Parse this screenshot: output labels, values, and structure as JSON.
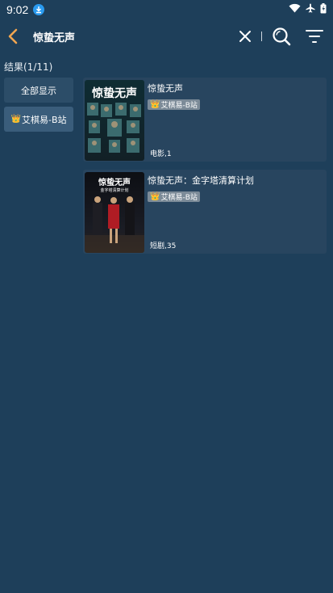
{
  "status_bar": {
    "time": "9:02"
  },
  "top_bar": {
    "query": "惊蛰无声"
  },
  "results": {
    "count_label": "结果(1/11)"
  },
  "filters": [
    {
      "label": "全部显示"
    },
    {
      "label": "艾棋易-B站"
    }
  ],
  "cards": [
    {
      "title": "惊蛰无声",
      "source": "艾棋易-B站",
      "meta": "电影,1",
      "poster_title": "惊蛰无声"
    },
    {
      "title": "惊蛰无声：金字塔清算计划",
      "source": "艾棋易-B站",
      "meta": "短剧,35",
      "poster_title": "惊蛰无声",
      "poster_subtitle": "金字塔清算计划"
    }
  ],
  "colors": {
    "background": "#1e3f5a",
    "card": "#28455f",
    "filter": "#2c4d68",
    "badge": "#7c8b98",
    "back_arrow": "#f0a550"
  }
}
